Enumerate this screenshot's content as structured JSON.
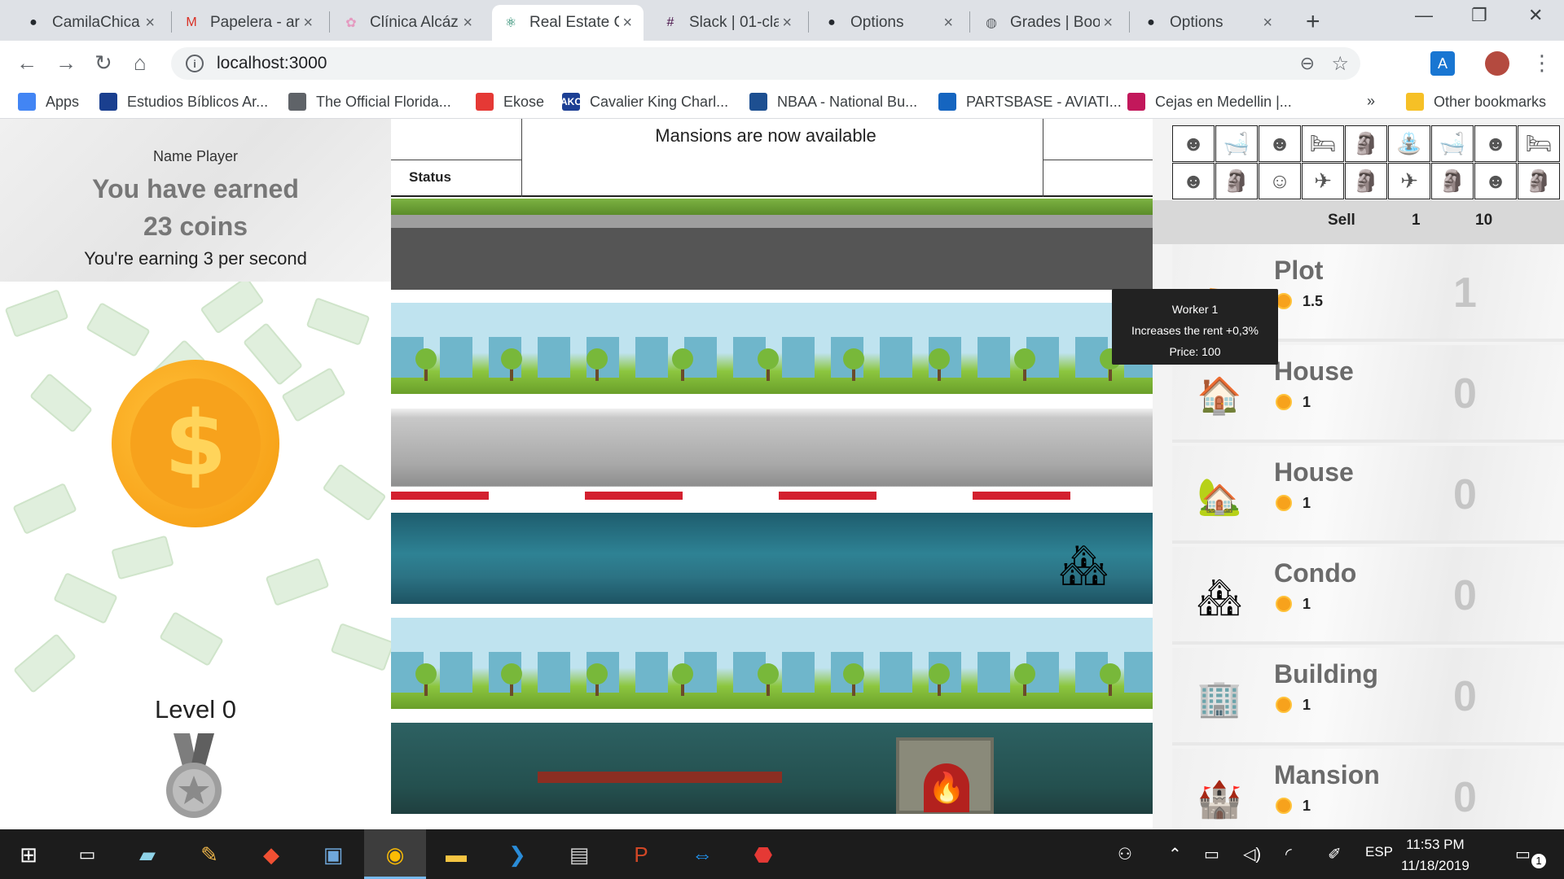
{
  "browser": {
    "tabs": [
      {
        "title": "CamilaChica",
        "icon": "github-icon",
        "glyph": "●",
        "color": "#24292e"
      },
      {
        "title": "Papelera - ar",
        "icon": "gmail-icon",
        "glyph": "M",
        "color": "#d93025"
      },
      {
        "title": "Clínica Alcáz",
        "icon": "clinic-icon",
        "glyph": "✿",
        "color": "#e59ac0"
      },
      {
        "title": "Real Estate C",
        "icon": "react-icon",
        "glyph": "⚛",
        "color": "#0a7a5a",
        "active": true
      },
      {
        "title": "Slack | 01-cla",
        "icon": "slack-icon",
        "glyph": "#",
        "color": "#4a154b"
      },
      {
        "title": "Options",
        "icon": "github-icon",
        "glyph": "●",
        "color": "#24292e"
      },
      {
        "title": "Grades | Boo",
        "icon": "globe-icon",
        "glyph": "◍",
        "color": "#5f6368"
      },
      {
        "title": "Options",
        "icon": "github-icon",
        "glyph": "●",
        "color": "#24292e"
      }
    ],
    "url": "localhost:3000",
    "bookmarks": [
      {
        "label": "Apps",
        "icon": "apps-grid-icon",
        "color": "#4285f4"
      },
      {
        "label": "Estudios Bíblicos Ar...",
        "icon": "bible-icon",
        "color": "#1a3f8f"
      },
      {
        "label": "The Official Florida...",
        "icon": "globe-icon",
        "color": "#5f6368"
      },
      {
        "label": "Ekose",
        "icon": "ekose-icon",
        "color": "#e53935"
      },
      {
        "label": "Cavalier King Charl...",
        "icon": "akc-icon",
        "color": "#1c3f94",
        "glyph": "AKC"
      },
      {
        "label": "NBAA - National Bu...",
        "icon": "nbaa-icon",
        "color": "#1d4f91"
      },
      {
        "label": "PARTSBASE - AVIATI...",
        "icon": "partsbase-icon",
        "color": "#1565c0"
      },
      {
        "label": "Cejas en Medellin |...",
        "icon": "cejas-icon",
        "color": "#c2185b"
      }
    ],
    "more_bookmarks": "»",
    "other_bookmarks": "Other bookmarks"
  },
  "game": {
    "player_name": "Name Player",
    "earned_line1": "You have earned",
    "earned_line2": "23 coins",
    "rate": "You're earning 3 per second",
    "level": "Level 0",
    "notice": "Mansions are now available",
    "status_label": "Status",
    "tooltip": {
      "name": "Worker 1",
      "effect": "Increases the rent +0,3%",
      "price": "Price: 100"
    },
    "buy_options": [
      "Sell",
      "1",
      "10"
    ],
    "upgrades_row1": [
      "worker-bust-icon",
      "bathtub-icon",
      "worker-bust-icon",
      "bed-icon",
      "moai-statue-icon",
      "fountain-icon",
      "bathtub-icon",
      "worker-bust-icon",
      "bed-icon"
    ],
    "upgrades_row2": [
      "worker-bust-icon",
      "moai-statue-icon",
      "bust-icon",
      "airplane-icon",
      "moai-statue-icon",
      "airplane-icon",
      "moai-statue-icon",
      "worker-bust-icon",
      "moai-statue-icon"
    ],
    "properties": [
      {
        "name": "Plot",
        "price": "1.5",
        "count": "1",
        "icon": "tent-icon",
        "glyph": "⛺"
      },
      {
        "name": "House",
        "price": "1",
        "count": "0",
        "icon": "house-icon",
        "glyph": "🏠"
      },
      {
        "name": "House",
        "price": "1",
        "count": "0",
        "icon": "house-icon",
        "glyph": "🏡"
      },
      {
        "name": "Condo",
        "price": "1",
        "count": "0",
        "icon": "condo-icon",
        "glyph": "🏘"
      },
      {
        "name": "Building",
        "price": "1",
        "count": "0",
        "icon": "building-icon",
        "glyph": "🏢"
      },
      {
        "name": "Mansion",
        "price": "1",
        "count": "0",
        "icon": "castle-icon",
        "glyph": "🏰"
      }
    ]
  },
  "taskbar": {
    "language": "ESP",
    "time": "11:53 PM",
    "date": "11/18/2019",
    "notification_count": "1"
  }
}
